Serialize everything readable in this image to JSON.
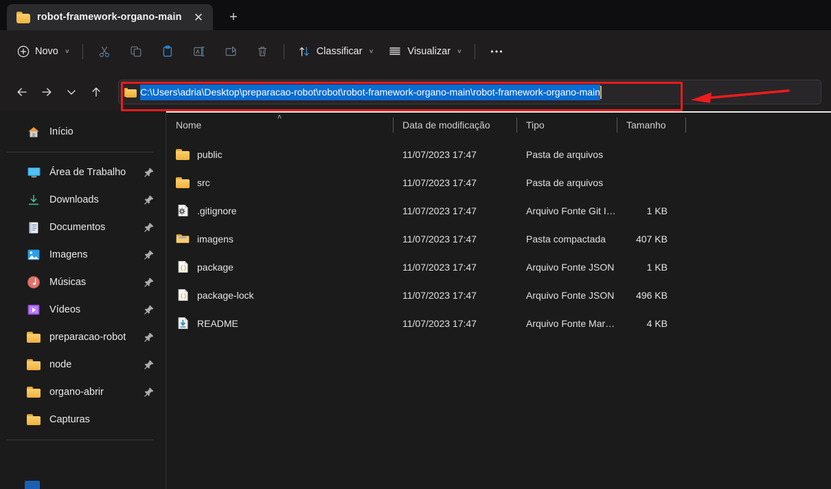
{
  "window": {
    "tab": {
      "title": "robot-framework-organo-main",
      "folder_icon": "folder-icon",
      "close_icon": "close-icon"
    },
    "new_tab_icon": "plus-icon"
  },
  "toolbar": {
    "new_label": "Novo",
    "new_icon": "plus-circle-icon",
    "cut_icon": "scissors-icon",
    "copy_icon": "copy-icon",
    "paste_icon": "paste-icon",
    "rename_icon": "rename-icon",
    "share_icon": "share-icon",
    "delete_icon": "trash-icon",
    "sort_label": "Classificar",
    "sort_icon": "sort-arrows-icon",
    "view_label": "Visualizar",
    "view_icon": "view-lines-icon",
    "more_icon": "ellipsis-icon",
    "chevron": "˅"
  },
  "navigation": {
    "back_icon": "arrow-left-icon",
    "forward_icon": "arrow-right-icon",
    "recent_icon": "chevron-down-icon",
    "up_icon": "arrow-up-icon"
  },
  "address": {
    "folder_icon": "folder-icon",
    "path": "C:\\Users\\adria\\Desktop\\preparacao-robot\\robot\\robot-framework-organo-main\\robot-framework-organo-main",
    "selected": true
  },
  "annotation": {
    "color": "#ee1c1c",
    "box_target": "address-bar",
    "arrow_direction": "left"
  },
  "sidebar": {
    "items": [
      {
        "label": "Início",
        "icon": "home-icon",
        "pinned": false
      },
      {
        "label": "Área de Trabalho",
        "icon": "desktop-icon",
        "pinned": true
      },
      {
        "label": "Downloads",
        "icon": "download-icon",
        "pinned": true
      },
      {
        "label": "Documentos",
        "icon": "documents-icon",
        "pinned": true
      },
      {
        "label": "Imagens",
        "icon": "pictures-icon",
        "pinned": true
      },
      {
        "label": "Músicas",
        "icon": "music-icon",
        "pinned": true
      },
      {
        "label": "Vídeos",
        "icon": "videos-icon",
        "pinned": true
      },
      {
        "label": "preparacao-robot",
        "icon": "folder-icon",
        "pinned": true
      },
      {
        "label": "node",
        "icon": "folder-icon",
        "pinned": true
      },
      {
        "label": "organo-abrir",
        "icon": "folder-icon",
        "pinned": true
      },
      {
        "label": "Capturas",
        "icon": "folder-icon",
        "pinned": false
      }
    ]
  },
  "file_list": {
    "columns": {
      "name": "Nome",
      "date": "Data de modificação",
      "type": "Tipo",
      "size": "Tamanho"
    },
    "sort": {
      "column": "Nome",
      "direction": "asc",
      "caret": "˄"
    },
    "rows": [
      {
        "name": "public",
        "date": "11/07/2023 17:47",
        "type": "Pasta de arquivos",
        "size": "",
        "icon": "folder-icon"
      },
      {
        "name": "src",
        "date": "11/07/2023 17:47",
        "type": "Pasta de arquivos",
        "size": "",
        "icon": "folder-icon"
      },
      {
        "name": ".gitignore",
        "date": "11/07/2023 17:47",
        "type": "Arquivo Fonte Git I…",
        "size": "1 KB",
        "icon": "gear-file-icon"
      },
      {
        "name": "imagens",
        "date": "11/07/2023 17:47",
        "type": "Pasta compactada",
        "size": "407 KB",
        "icon": "zip-folder-icon"
      },
      {
        "name": "package",
        "date": "11/07/2023 17:47",
        "type": "Arquivo Fonte JSON",
        "size": "1 KB",
        "icon": "json-file-icon"
      },
      {
        "name": "package-lock",
        "date": "11/07/2023 17:47",
        "type": "Arquivo Fonte JSON",
        "size": "496 KB",
        "icon": "json-file-icon"
      },
      {
        "name": "README",
        "date": "11/07/2023 17:47",
        "type": "Arquivo Fonte Mar…",
        "size": "4 KB",
        "icon": "markdown-file-icon"
      }
    ]
  }
}
